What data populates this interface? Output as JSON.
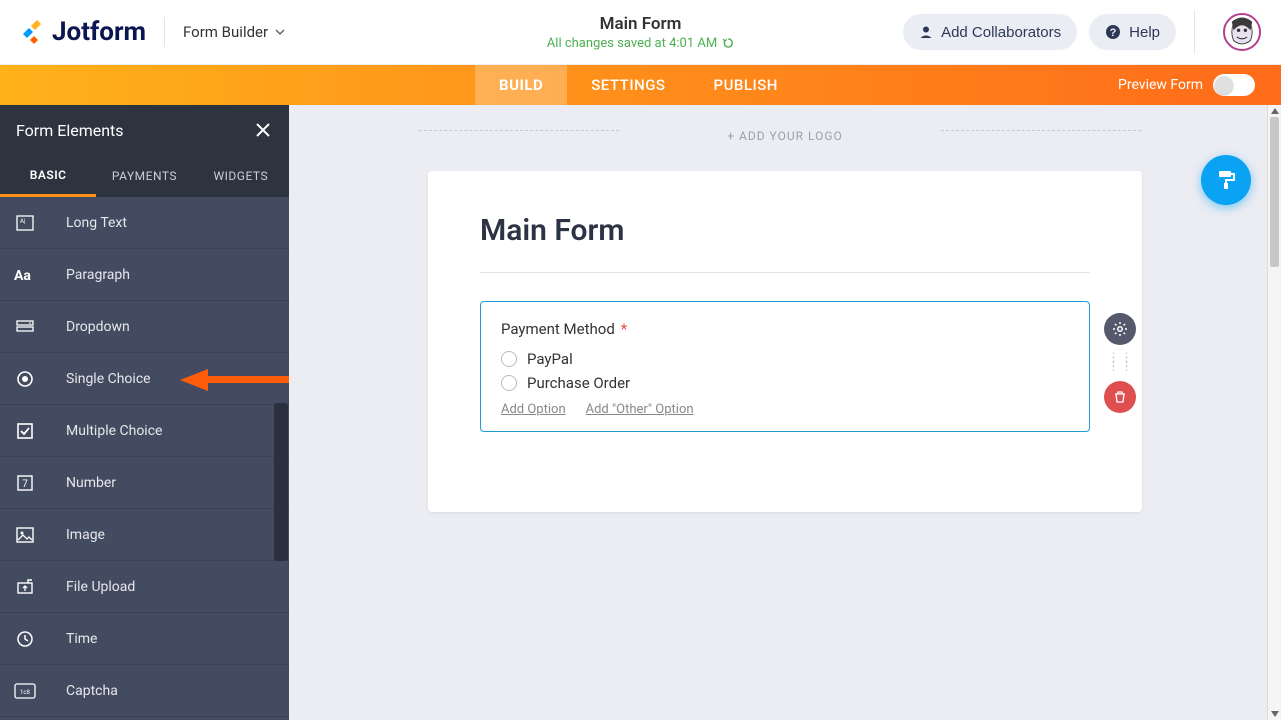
{
  "header": {
    "logo_text": "Jotform",
    "breadcrumb": "Form Builder",
    "title": "Main Form",
    "saved_text": "All changes saved at 4:01 AM",
    "add_collaborators": "Add Collaborators",
    "help": "Help"
  },
  "tabbar": {
    "tabs": [
      "BUILD",
      "SETTINGS",
      "PUBLISH"
    ],
    "active": "BUILD",
    "preview_label": "Preview Form",
    "preview_on": false
  },
  "sidebar": {
    "title": "Form Elements",
    "tabs": [
      "BASIC",
      "PAYMENTS",
      "WIDGETS"
    ],
    "active": "BASIC",
    "items": [
      {
        "icon": "long-text-icon",
        "label": "Long Text"
      },
      {
        "icon": "paragraph-icon",
        "label": "Paragraph"
      },
      {
        "icon": "dropdown-icon",
        "label": "Dropdown"
      },
      {
        "icon": "single-choice-icon",
        "label": "Single Choice",
        "pointed": true
      },
      {
        "icon": "multiple-choice-icon",
        "label": "Multiple Choice"
      },
      {
        "icon": "number-icon",
        "label": "Number"
      },
      {
        "icon": "image-icon",
        "label": "Image"
      },
      {
        "icon": "file-upload-icon",
        "label": "File Upload"
      },
      {
        "icon": "time-icon",
        "label": "Time"
      },
      {
        "icon": "captcha-icon",
        "label": "Captcha"
      }
    ]
  },
  "canvas": {
    "add_logo": "+ ADD YOUR LOGO",
    "form_title": "Main Form",
    "field": {
      "label": "Payment Method",
      "required": true,
      "options": [
        "PayPal",
        "Purchase Order"
      ],
      "add_option": "Add Option",
      "add_other": "Add \"Other\" Option"
    }
  }
}
